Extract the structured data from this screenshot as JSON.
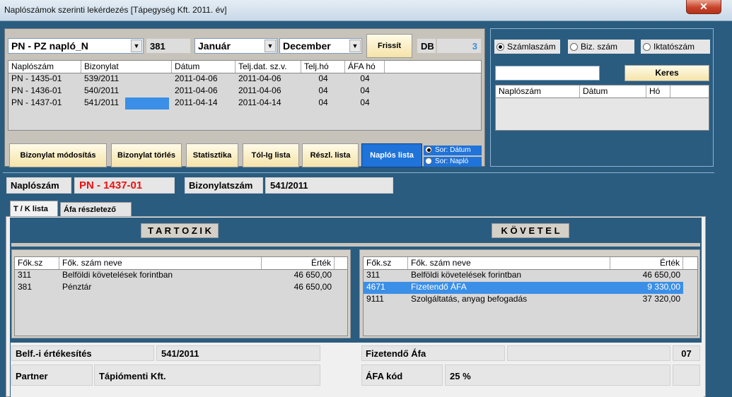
{
  "window": {
    "title": "Naplószámok szerinti lekérdezés  [Tápegység Kft.  2011. év]",
    "close": "✕"
  },
  "top": {
    "journal": "PN  -  PZ napló_N",
    "journal_no": "381",
    "month_from": "Január",
    "month_to": "December",
    "refresh": "Frissít",
    "db_label": "DB",
    "db_value": "3"
  },
  "list": {
    "headers": [
      "Naplószám",
      "Bizonylat",
      "Dátum",
      "Telj.dat. sz.v.",
      "Telj.hó",
      "ÁFA hó"
    ],
    "rows": [
      [
        "PN - 1435-01",
        "539/2011",
        "2011-04-06",
        "2011-04-06",
        "04",
        "04"
      ],
      [
        "PN - 1436-01",
        "540/2011",
        "2011-04-06",
        "2011-04-06",
        "04",
        "04"
      ],
      [
        "PN - 1437-01",
        "541/2011",
        "2011-04-14",
        "2011-04-14",
        "04",
        "04"
      ]
    ]
  },
  "buttons": {
    "modify": "Bizonylat módosítás",
    "delete": "Bizonylat törlés",
    "stats": "Statisztika",
    "fromto": "Tól-Ig lista",
    "detail": "Részl. lista",
    "journal_list": "Naplós lista",
    "sort_date": "Sor: Dátum",
    "sort_journal": "Sor: Napló"
  },
  "search": {
    "opt1": "Számlaszám",
    "opt2": "Biz. szám",
    "opt3": "Iktatószám",
    "input": "",
    "button": "Keres",
    "headers": [
      "Naplószám",
      "Dátum",
      "Hó"
    ]
  },
  "detail": {
    "naplo_label": "Naplószám",
    "naplo_value": "PN - 1437-01",
    "biz_label": "Bizonylatszám",
    "biz_value": "541/2011"
  },
  "tabs": [
    "T / K lista",
    "Áfa részletező"
  ],
  "tartozik": {
    "title": "T A R T O Z I K",
    "headers": [
      "Fők.sz",
      "Fők. szám neve",
      "Érték"
    ],
    "rows": [
      [
        "311",
        "Belföldi  követelések forintban",
        "46 650,00"
      ],
      [
        "381",
        "Pénztár",
        "46 650,00"
      ]
    ]
  },
  "kovetel": {
    "title": "K Ö V E T E L",
    "headers": [
      "Fők.sz",
      "Fők. szám neve",
      "Érték"
    ],
    "rows": [
      [
        "311",
        "Belföldi  követelések forintban",
        "46 650,00"
      ],
      [
        "4671",
        "Fizetendő ÁFA",
        "9 330,00"
      ],
      [
        "9111",
        "Szolgáltatás, anyag befogadás",
        "37 320,00"
      ]
    ]
  },
  "bottom": {
    "left_label1": "Belf.-i értékesítés",
    "left_value1": "541/2011",
    "left_label2": "Partner",
    "left_value2": "Tápiómenti Kft.",
    "right_label1": "Fizetendő Áfa",
    "right_value1": "",
    "right_code1": "07",
    "right_label2": "ÁFA kód",
    "right_value2": "25 %"
  }
}
